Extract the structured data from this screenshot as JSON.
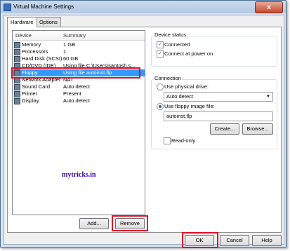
{
  "window": {
    "title": "Virtual Machine Settings",
    "close_glyph": "x"
  },
  "tabs": [
    {
      "label": "Hardware"
    },
    {
      "label": "Options"
    }
  ],
  "device_list": {
    "headers": {
      "device": "Device",
      "summary": "Summary"
    },
    "rows": [
      {
        "device": "Memory",
        "summary": "1 GB"
      },
      {
        "device": "Processors",
        "summary": "1"
      },
      {
        "device": "Hard Disk (SCSI)",
        "summary": "60 GB"
      },
      {
        "device": "CD/DVD (IDE)",
        "summary": "Using file C:\\Users\\santosh.s..."
      },
      {
        "device": "Floppy",
        "summary": "Using file autoinst.flp"
      },
      {
        "device": "Network Adapter",
        "summary": "NAT"
      },
      {
        "device": "Sound Card",
        "summary": "Auto detect"
      },
      {
        "device": "Printer",
        "summary": "Present"
      },
      {
        "device": "Display",
        "summary": "Auto detect"
      }
    ],
    "selected_index": 4
  },
  "watermark": "mytricks.in",
  "buttons": {
    "add": "Add...",
    "remove": "Remove",
    "ok": "OK",
    "cancel": "Cancel",
    "help": "Help"
  },
  "device_status": {
    "title": "Device status",
    "connected": {
      "label": "Connected",
      "checked": true
    },
    "connect_at_power_on": {
      "label": "Connect at power on",
      "checked": true
    }
  },
  "connection": {
    "title": "Connection",
    "use_physical_drive": {
      "label": "Use physical drive:",
      "selected": false
    },
    "physical_drive_value": "Auto detect",
    "use_floppy_image": {
      "label": "Use floppy image file:",
      "selected": true
    },
    "image_file_value": "autoinst.flp",
    "create_button": "Create...",
    "browse_button": "Browse...",
    "read_only": {
      "label": "Read-only",
      "checked": false
    }
  },
  "colors": {
    "selection": "#3399ff",
    "highlight_border": "#e0102a",
    "watermark": "#3c00a0"
  }
}
